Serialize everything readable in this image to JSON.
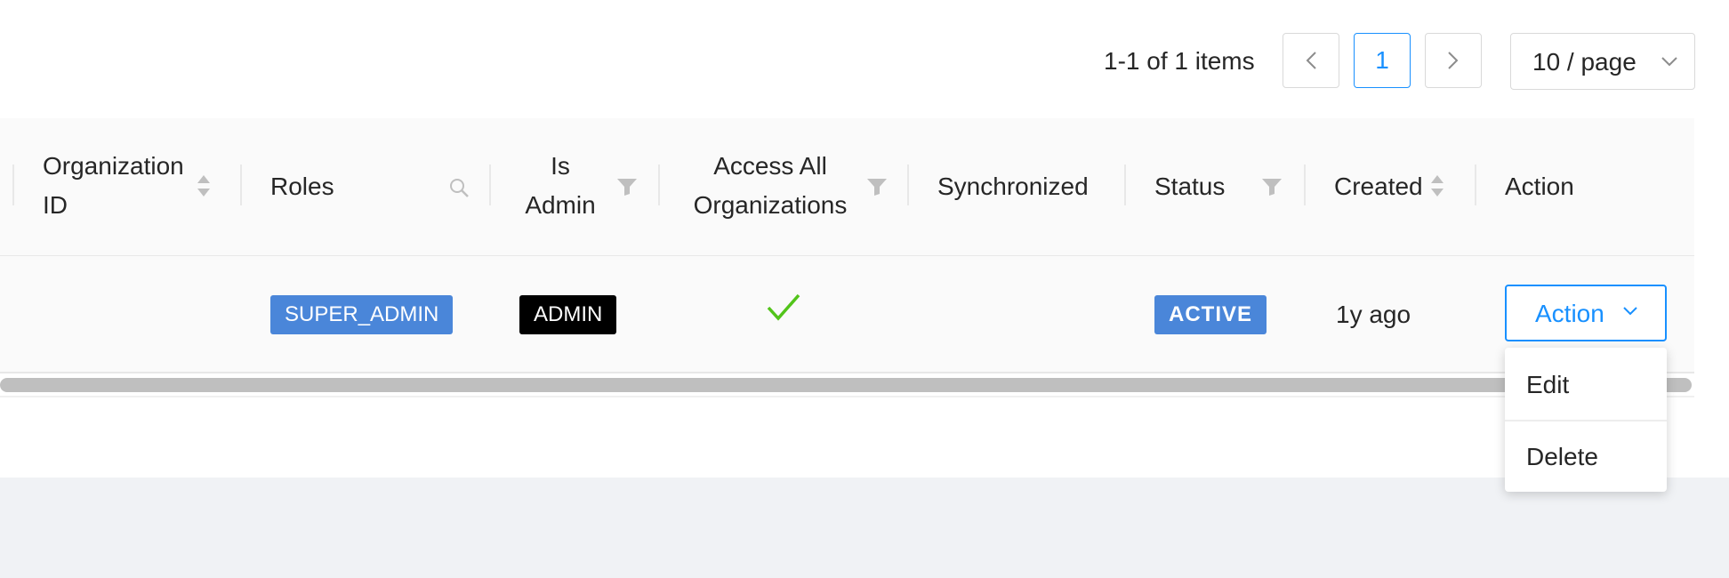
{
  "pagination": {
    "total_text": "1-1 of 1 items",
    "prev_icon": "chevron-left-icon",
    "current_page": "1",
    "next_icon": "chevron-right-icon",
    "page_size": "10 / page"
  },
  "table": {
    "columns": {
      "organization_id": [
        "Organization",
        "ID"
      ],
      "roles": "Roles",
      "is_admin": [
        "Is",
        "Admin"
      ],
      "access_all_orgs": [
        "Access All",
        "Organizations"
      ],
      "synchronized": "Synchronized",
      "status": "Status",
      "created": "Created",
      "action": "Action"
    },
    "row": {
      "organization_id": "",
      "role_tag": "SUPER_ADMIN",
      "admin_tag": "ADMIN",
      "access_all_orgs_icon": "checkmark-icon",
      "synchronized": "",
      "status": "ACTIVE",
      "created": "1y ago",
      "action_label": "Action"
    }
  },
  "action_menu": {
    "items": [
      "Edit",
      "Delete"
    ]
  },
  "colors": {
    "primary": "#1890ff",
    "tag_blue": "#4a86d9",
    "check_green": "#52c41a"
  }
}
